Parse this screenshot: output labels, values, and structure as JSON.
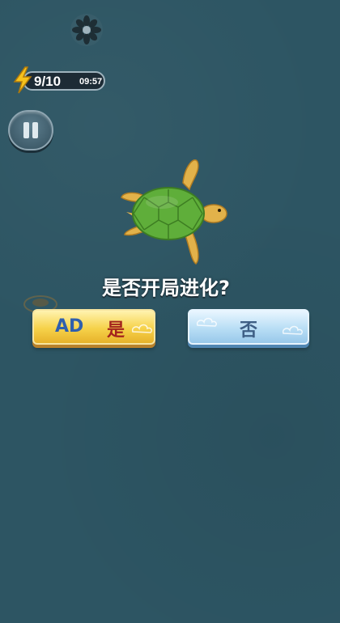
{
  "hud": {
    "energy_count": "9/10",
    "energy_timer": "09:57",
    "icons": {
      "energy": "lightning-bolt-icon",
      "pause": "pause-icon",
      "top": "flower-icon"
    }
  },
  "dialog": {
    "question": "是否开局进化?",
    "yes_button": {
      "ad_tag": "AD",
      "label": "是"
    },
    "no_button": {
      "label": "否"
    }
  },
  "colors": {
    "background": "#2d5563",
    "yes_button": "#f6d24a",
    "no_button": "#b9def5",
    "turtle_shell": "#5fae3a",
    "turtle_skin": "#e2b24a"
  }
}
